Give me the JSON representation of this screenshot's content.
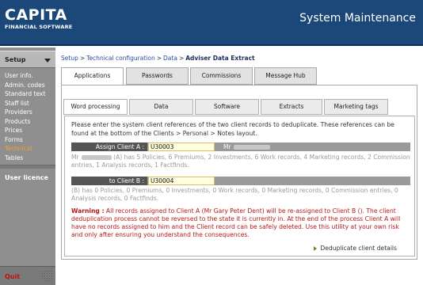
{
  "header": {
    "logo_main": "CAPITA",
    "logo_sub": "FINANCIAL SOFTWARE",
    "title": "System Maintenance"
  },
  "sidebar": {
    "section": "Setup",
    "items": [
      {
        "label": "User info."
      },
      {
        "label": "Admin. codes"
      },
      {
        "label": "Standard text"
      },
      {
        "label": "Staff list"
      },
      {
        "label": "Providers"
      },
      {
        "label": "Products"
      },
      {
        "label": "Prices"
      },
      {
        "label": "Forms"
      },
      {
        "label": "Technical",
        "active": true
      },
      {
        "label": "Tables"
      }
    ],
    "licence": "User licence",
    "quit": "Quit"
  },
  "breadcrumb": {
    "items": [
      "Setup",
      "Technical configuration",
      "Data"
    ],
    "current": "Adviser Data Extract"
  },
  "tabs": [
    {
      "label": "Applications",
      "active": true
    },
    {
      "label": "Passwords"
    },
    {
      "label": "Commissions"
    },
    {
      "label": "Message Hub"
    }
  ],
  "subtabs": [
    {
      "label": "Word processing",
      "active": true
    },
    {
      "label": "Data"
    },
    {
      "label": "Software"
    },
    {
      "label": "Extracts"
    },
    {
      "label": "Marketing tags"
    }
  ],
  "content": {
    "intro": "Please enter the system client references of the two client records to deduplicate.  These references can be found at the bottom of the Clients > Personal > Notes layout.",
    "client_a": {
      "label": "Assign Client A :",
      "value": "U30003",
      "name_prefix": "Mr",
      "info_prefix": "Mr",
      "info": "(A) has 5 Policies, 6 Premiums, 2 Investments, 6 Work records, 4 Marketing records, 2 Commission entries, 1 Analysis records, 1 Factfinds."
    },
    "client_b": {
      "label": "to Client B :",
      "value": "U30004",
      "info": "(B) has 0 Policies, 0 Premiums, 0 Investments, 0 Work records, 0 Marketing records, 0 Commission entries, 0 Analysis records, 0 Factfinds."
    },
    "warning_label": "Warning :",
    "warning_text": " All records assigned to Client A (Mr Gary Peter Dent) will be re-assigned to Client B ().  The client deduplication process cannot be reversed to the state it is currently in.  At the end of the process Client A will have no records assigned to him and the Client record can be safely deleted.  Use this utility at your own risk and only after ensuring you understand the consequences.",
    "action": "Deduplicate client details"
  }
}
